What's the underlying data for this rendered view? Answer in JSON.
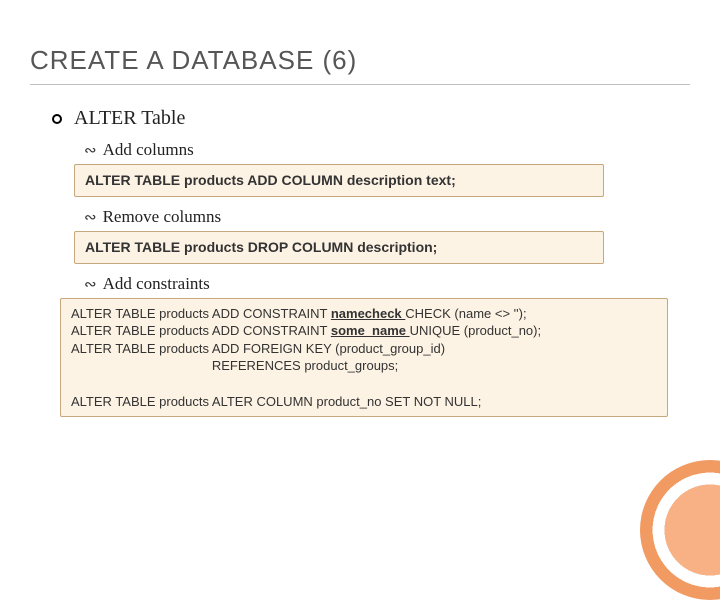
{
  "title": "CREATE A DATABASE (6)",
  "lvl1": {
    "text": "ALTER Table"
  },
  "items": {
    "add_cols": {
      "label": "Add columns",
      "code": "ALTER TABLE products ADD COLUMN description text;"
    },
    "remove_cols": {
      "label": "Remove columns",
      "code": "ALTER TABLE products DROP COLUMN description;"
    },
    "add_constraints": {
      "label": "Add constraints",
      "code_lines": {
        "l1a": "ALTER TABLE products ADD CONSTRAINT ",
        "l1b": "namecheck ",
        "l1c": "CHECK (name <> '');",
        "l2a": "ALTER TABLE products ADD CONSTRAINT ",
        "l2b": "some_name ",
        "l2c": "UNIQUE (product_no);",
        "l3": "ALTER TABLE products ADD FOREIGN KEY (product_group_id)",
        "l4": "                                       REFERENCES product_groups;",
        "blank": " ",
        "l5": "ALTER TABLE products ALTER COLUMN product_no SET NOT NULL;"
      }
    }
  }
}
